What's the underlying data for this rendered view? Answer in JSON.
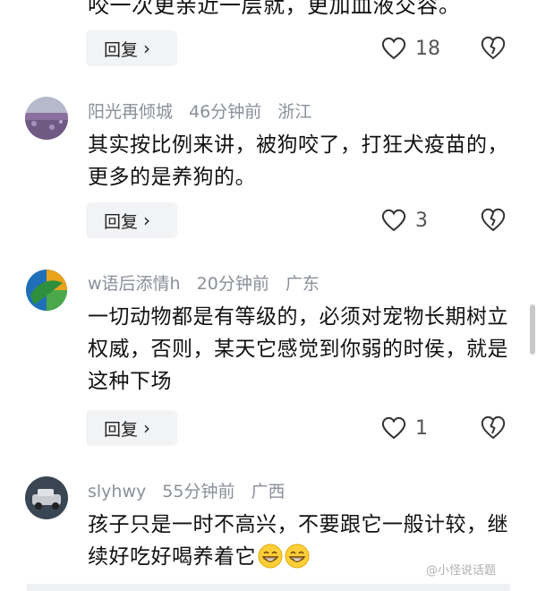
{
  "partial_comment": {
    "text": "咬一次更亲近一层就，更加血液交容。"
  },
  "first_actions": {
    "reply_label": "回复",
    "like_count": "18"
  },
  "comments": [
    {
      "username": "阳光再倾城",
      "time": "46分钟前",
      "location": "浙江",
      "text": "其实按比例来讲，被狗咬了，打狂犬疫苗的，更多的是养狗的。",
      "reply_label": "回复",
      "like_count": "3",
      "avatar": "lavender-field-avatar"
    },
    {
      "username": "w语后添情h",
      "time": "20分钟前",
      "location": "广东",
      "text": "一切动物都是有等级的，必须对宠物长期树立权威，否则，某天它感觉到你弱的时侯，就是这种下场",
      "reply_label": "回复",
      "like_count": "1",
      "avatar": "green-blue-orb-avatar"
    },
    {
      "username": "slyhwy",
      "time": "55分钟前",
      "location": "广西",
      "text": "孩子只是一时不高兴，不要跟它一般计较，继续好吃好喝养着它",
      "avatar": "toy-car-avatar",
      "emoji": "grinning-face-emoji"
    }
  ],
  "watermark": "@小怪说话题",
  "icons": {
    "like": "heart-outline-icon",
    "dislike": "broken-heart-icon",
    "chevron": "chevron-right-icon"
  }
}
